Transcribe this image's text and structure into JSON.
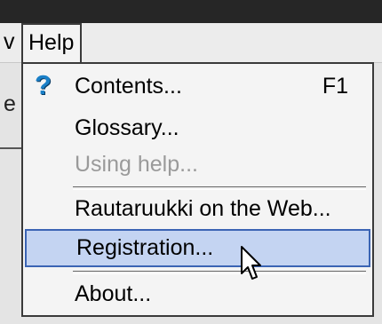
{
  "menubar": {
    "clipped_item": "v",
    "help_label": "Help"
  },
  "background": {
    "clipped_glyph": "e"
  },
  "help_menu": {
    "items": [
      {
        "label": "Contents...",
        "shortcut": "F1",
        "icon": "question-mark-icon",
        "disabled": false
      },
      {
        "label": "Glossary...",
        "disabled": false
      },
      {
        "label": "Using help...",
        "disabled": true
      },
      {
        "label": "Rautaruukki on the Web...",
        "disabled": false
      },
      {
        "label": "Registration...",
        "disabled": false,
        "selected": true
      },
      {
        "label": "About...",
        "disabled": false
      }
    ]
  },
  "colors": {
    "highlight_fill": "#c4d4f2",
    "highlight_border": "#3b64b4",
    "icon_blue": "#1a7fc7",
    "disabled_text": "#9a9a9a"
  },
  "cursor": {
    "icon": "arrow-pointer-icon"
  }
}
